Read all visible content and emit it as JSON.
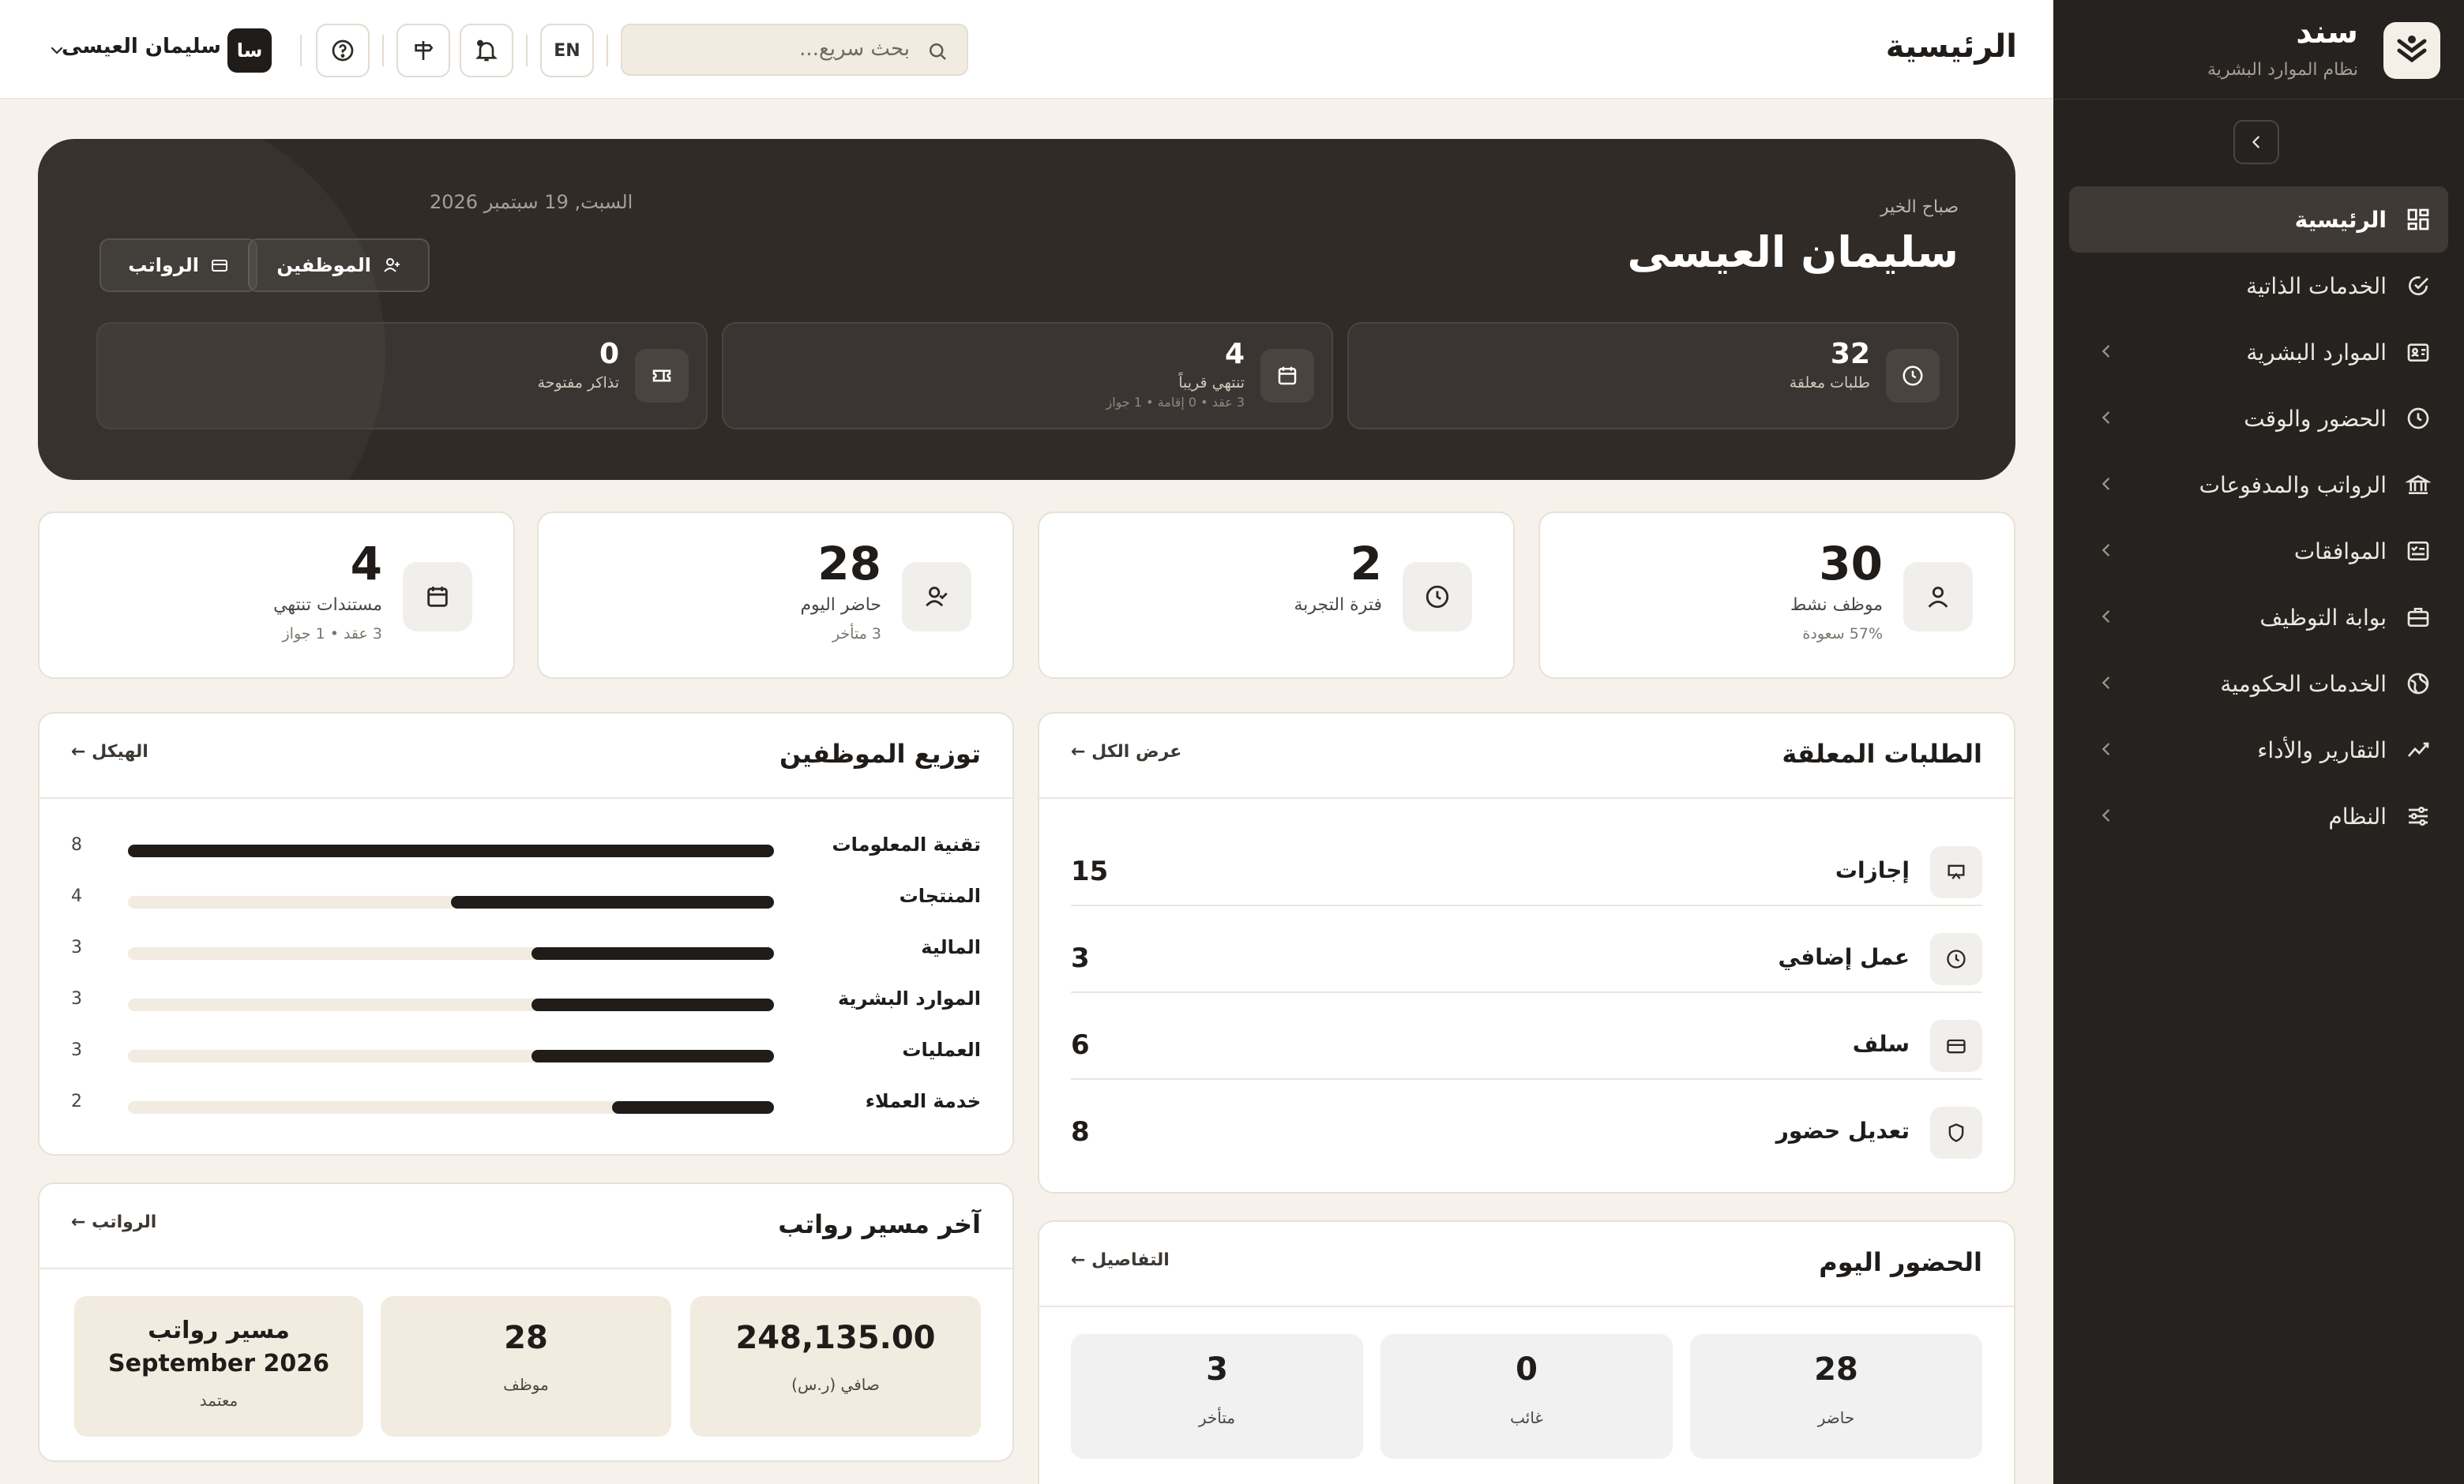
{
  "brand": {
    "name": "سند",
    "subtitle": "نظام الموارد البشرية"
  },
  "sidebar": {
    "items": [
      {
        "label": "الرئيسية",
        "icon": "dashboard-icon",
        "active": true,
        "chevron": false
      },
      {
        "label": "الخدمات الذاتية",
        "icon": "calendar-check-icon",
        "active": false,
        "chevron": false
      },
      {
        "label": "الموارد البشرية",
        "icon": "id-card-icon",
        "active": false,
        "chevron": true
      },
      {
        "label": "الحضور والوقت",
        "icon": "clock-icon",
        "active": false,
        "chevron": true
      },
      {
        "label": "الرواتب والمدفوعات",
        "icon": "bank-icon",
        "active": false,
        "chevron": true
      },
      {
        "label": "الموافقات",
        "icon": "checklist-icon",
        "active": false,
        "chevron": true
      },
      {
        "label": "بوابة التوظيف",
        "icon": "briefcase-icon",
        "active": false,
        "chevron": true
      },
      {
        "label": "الخدمات الحكومية",
        "icon": "globe-icon",
        "active": false,
        "chevron": true
      },
      {
        "label": "التقارير والأداء",
        "icon": "trend-icon",
        "active": false,
        "chevron": true
      },
      {
        "label": "النظام",
        "icon": "sliders-icon",
        "active": false,
        "chevron": true
      }
    ]
  },
  "topbar": {
    "title": "الرئيسية",
    "search_placeholder": "بحث سريع...",
    "lang": "EN",
    "user_initials": "سا",
    "user_name": "سليمان العيسى"
  },
  "hero": {
    "greeting": "صباح الخير",
    "name": "سليمان العيسى",
    "date": "السبت, 19 سبتمبر 2026",
    "buttons": {
      "employees": "الموظفين",
      "payroll": "الرواتب"
    },
    "stats": [
      {
        "value": "32",
        "label": "طلبات معلقة",
        "sub": ""
      },
      {
        "value": "4",
        "label": "تنتهي قريباً",
        "sub": "3 عقد • 0 إقامة • 1 جواز"
      },
      {
        "value": "0",
        "label": "تذاكر مفتوحة",
        "sub": ""
      }
    ]
  },
  "kpis": [
    {
      "value": "30",
      "label": "موظف نشط",
      "sub": "57% سعودة"
    },
    {
      "value": "2",
      "label": "فترة التجربة",
      "sub": ""
    },
    {
      "value": "28",
      "label": "حاضر اليوم",
      "sub": "3 متأخر"
    },
    {
      "value": "4",
      "label": "مستندات تنتهي",
      "sub": "3 عقد • 1 جواز"
    }
  ],
  "pending": {
    "title": "الطلبات المعلقة",
    "link": "عرض الكل ←",
    "rows": [
      {
        "label": "إجازات",
        "value": "15"
      },
      {
        "label": "عمل إضافي",
        "value": "3"
      },
      {
        "label": "سلف",
        "value": "6"
      },
      {
        "label": "تعديل حضور",
        "value": "8"
      }
    ]
  },
  "distribution": {
    "title": "توزيع الموظفين",
    "link": "الهيكل ←",
    "max": 8,
    "rows": [
      {
        "label": "تقنية المعلومات",
        "value": 8
      },
      {
        "label": "المنتجات",
        "value": 4
      },
      {
        "label": "المالية",
        "value": 3
      },
      {
        "label": "الموارد البشرية",
        "value": 3
      },
      {
        "label": "العمليات",
        "value": 3
      },
      {
        "label": "خدمة العملاء",
        "value": 2
      }
    ]
  },
  "attendance": {
    "title": "الحضور اليوم",
    "link": "التفاصيل ←",
    "tiles": [
      {
        "value": "28",
        "label": "حاضر"
      },
      {
        "value": "0",
        "label": "غائب"
      },
      {
        "value": "3",
        "label": "متأخر"
      }
    ]
  },
  "payroll": {
    "title": "آخر مسير رواتب",
    "link": "الرواتب ←",
    "net_value": "248,135.00",
    "net_label": "صافي (ر.س)",
    "emp_value": "28",
    "emp_label": "موظف",
    "run_title": "مسير رواتب",
    "run_period": "September 2026",
    "run_status": "معتمد"
  },
  "colors": {
    "sidebar": "#26221f",
    "hero": "#302b27",
    "accent": "#1f1c1a",
    "background": "#f6f2eb",
    "tile_beige": "#f2ebdf",
    "tile_gray": "#f1f1f2"
  }
}
